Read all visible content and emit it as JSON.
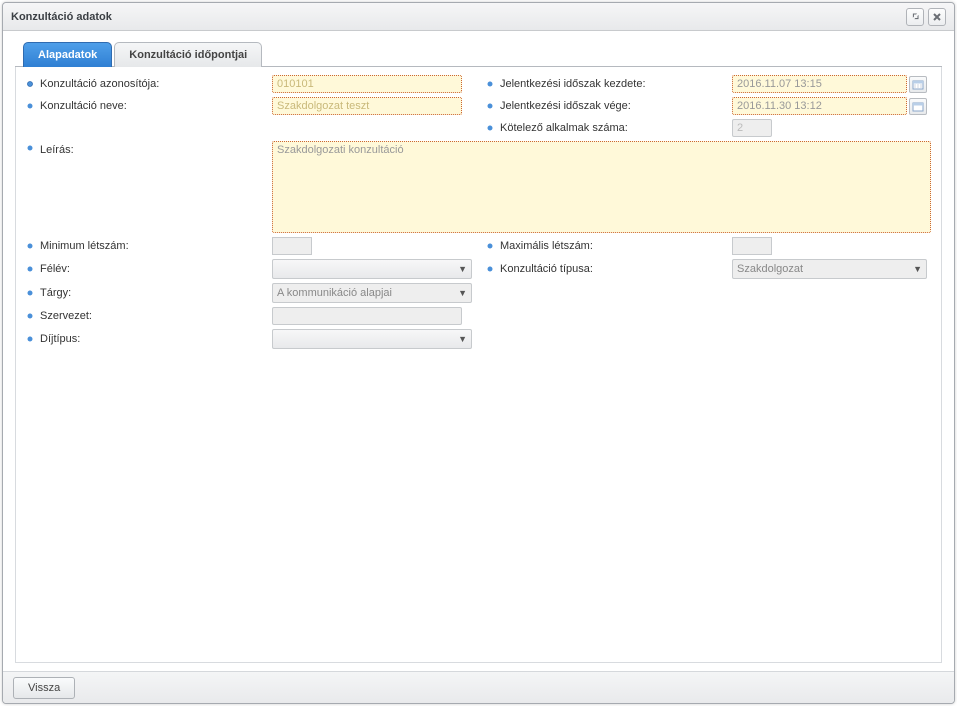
{
  "window": {
    "title": "Konzultáció adatok"
  },
  "tabs": {
    "alapadatok": "Alapadatok",
    "idopontjai": "Konzultáció időpontjai"
  },
  "labels": {
    "azonosito": "Konzultáció azonosítója:",
    "neve": "Konzultáció neve:",
    "leiras": "Leírás:",
    "min_letszam": "Minimum létszám:",
    "felev": "Félév:",
    "targy": "Tárgy:",
    "szervezet": "Szervezet:",
    "dijtipus": "Díjtípus:",
    "jel_kezdet": "Jelentkezési időszak kezdete:",
    "jel_vege": "Jelentkezési időszak vége:",
    "kotelezo": "Kötelező alkalmak száma:",
    "max_letszam": "Maximális létszám:",
    "konz_tipus": "Konzultáció típusa:"
  },
  "values": {
    "azonosito": "010101",
    "neve": "Szakdolgozat teszt",
    "leiras": "Szakdolgozati konzultáció",
    "jel_kezdet": "2016.11.07 13:15",
    "jel_vege": "2016.11.30 13:12",
    "kotelezo": "2",
    "felev": "",
    "targy": "A kommunikáció alapjai",
    "szervezet": "",
    "dijtipus": "",
    "konz_tipus": "Szakdolgozat",
    "min_letszam": "",
    "max_letszam": ""
  },
  "footer": {
    "back": "Vissza"
  }
}
